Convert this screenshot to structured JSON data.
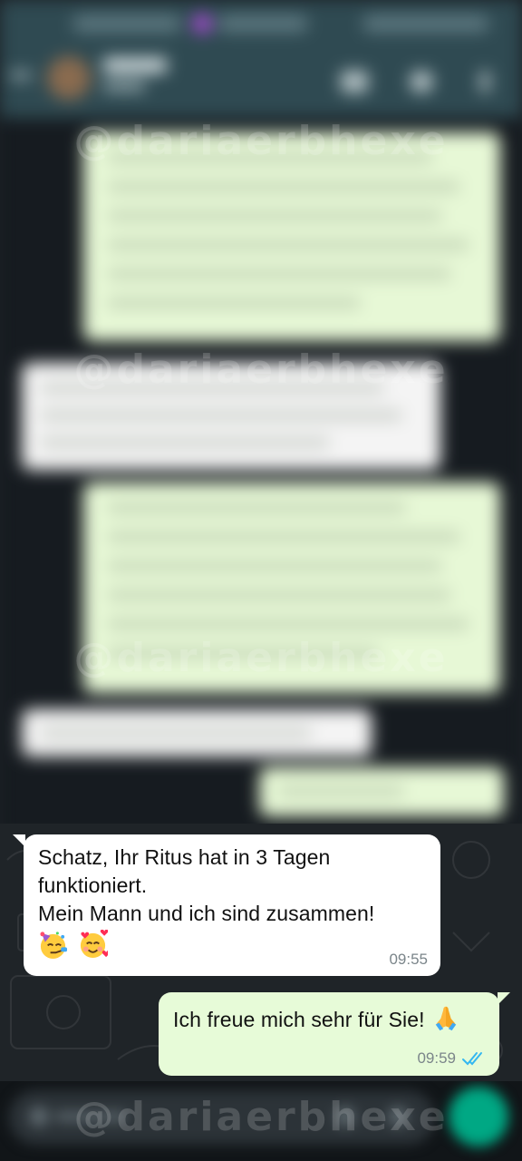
{
  "watermark": "@dariaerbhexe",
  "messages": [
    {
      "direction": "incoming",
      "lines": [
        "Schatz, Ihr Ritus hat in 3 Tagen",
        "funktioniert.",
        "Mein Mann und ich sind zusammen!"
      ],
      "emojis": [
        "partying-face",
        "smiling-face-with-hearts"
      ],
      "time": "09:55"
    },
    {
      "direction": "outgoing",
      "text": "Ich freue mich sehr für Sie!",
      "emoji": "folded-hands",
      "time": "09:59",
      "status": "read"
    }
  ],
  "colors": {
    "header": "#2f4a52",
    "chat_background": "#1f2428",
    "incoming_bubble": "#ffffff",
    "outgoing_bubble": "#e7fbd8",
    "read_ticks": "#34b7f1",
    "send_button": "#00a884"
  }
}
